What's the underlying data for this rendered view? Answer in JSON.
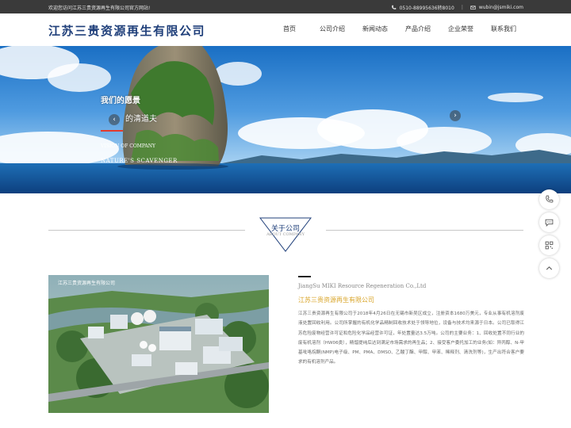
{
  "topbar": {
    "welcome": "欢迎您访问江苏三贵资源再生有限公司官方网站!",
    "phone": "0510-88995636转8010",
    "divider": "|",
    "email": "wubin@jsmiki.com"
  },
  "header": {
    "logo": "江苏三贵资源再生有限公司",
    "nav": [
      "首页",
      "公司介绍",
      "新闻动态",
      "产品介绍",
      "企业荣誉",
      "联系我们"
    ]
  },
  "banner": {
    "slogan_line1": "我们的愿景",
    "slogan_line2": "的清道夫",
    "slogan_en1": "VISION OF COMPANY",
    "slogan_en2": "NATURE'S SCAVENGER",
    "prev": "‹",
    "next": "›"
  },
  "about": {
    "title_cn": "关于公司",
    "title_en": "ABOUT COMPANY",
    "photo_caption": "江苏三贵资源再生有限公司",
    "company_en": "JiangSu MIKI Resource Regeneration Co.,Ltd",
    "company_cn": "江苏三贵资源再生有限公司",
    "description": "江苏三贵资源再生有限公司于2018年4月26日在无锡市新吴区成立，注册资本1680万美元，专业从事有机溶剂废液处置回收利用。公司所掌握的有机化学品精制回收技术处于领导地位，设备与技术均来源于日本。公司已取得江苏危险废物经营许可证和危险化学品经营许可证，年处置量达3.5万吨。公司的主要业务：1、回收处置不同行业的废有机溶剂（HW06类），精馏提纯后达到满足市场需求的再生品；2、接受客户委托加工的业务(如：异丙醇、N-甲基吡咯烷酮(NMP)电子级、PM、PMA、DMSO、乙酸丁酯、甲醇、甲苯、稀释剂、清洗剂等)，生产出符合客户要求的有机溶剂产品。"
  },
  "colors": {
    "topbar": "#3a3a3a",
    "brand": "#1f3f7a",
    "accent_red": "#d9302a",
    "accent_gold": "#d9a52a"
  },
  "side": [
    "phone-icon",
    "chat-icon",
    "qrcode-icon",
    "chevron-up-icon"
  ]
}
